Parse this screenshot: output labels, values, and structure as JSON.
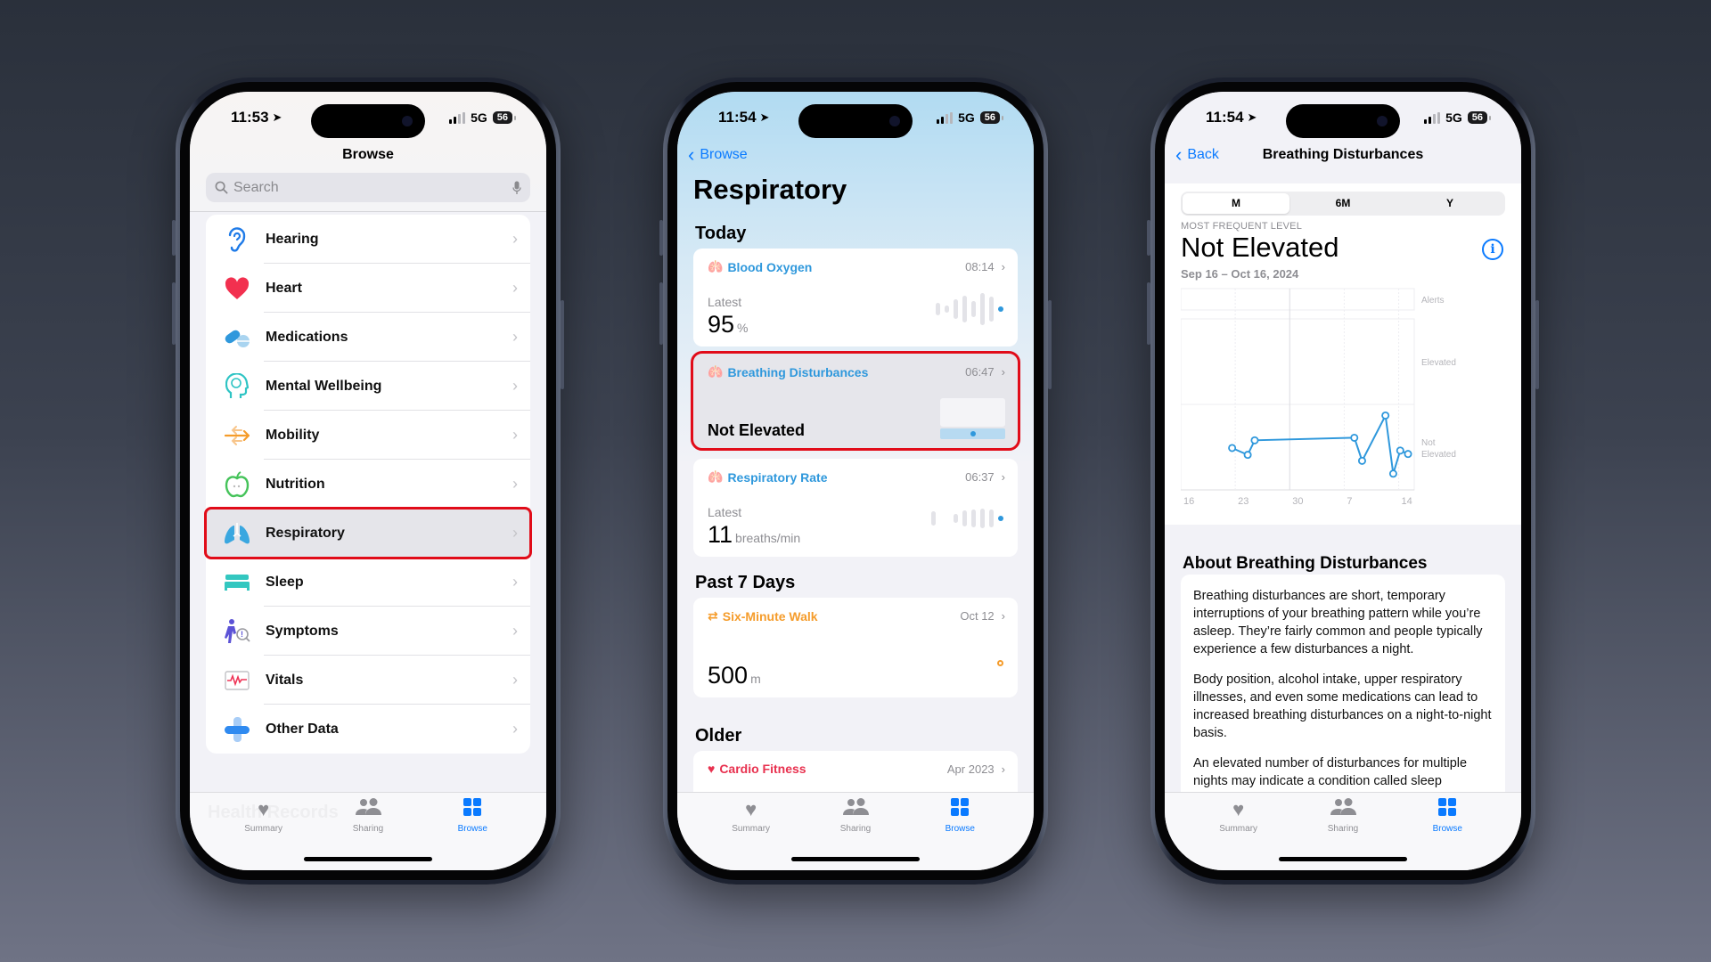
{
  "phones": [
    {
      "status": {
        "time": "11:53",
        "network": "5G",
        "battery": "56"
      },
      "nav_title": "Browse",
      "search": {
        "placeholder": "Search"
      },
      "categories": [
        {
          "label": "Hearing",
          "icon": "ear-icon",
          "color": "#1f7be8"
        },
        {
          "label": "Heart",
          "icon": "heart-icon",
          "color": "#f2304f"
        },
        {
          "label": "Medications",
          "icon": "pill-icon",
          "color": "#2f98dc"
        },
        {
          "label": "Mental Wellbeing",
          "icon": "brain-head-icon",
          "color": "#2ec4c4"
        },
        {
          "label": "Mobility",
          "icon": "arrows-icon",
          "color": "#f59c2b"
        },
        {
          "label": "Nutrition",
          "icon": "apple-icon",
          "color": "#45c35a"
        },
        {
          "label": "Respiratory",
          "icon": "lungs-icon",
          "color": "#3aa7e0",
          "highlighted": true
        },
        {
          "label": "Sleep",
          "icon": "bed-icon",
          "color": "#33c7c0"
        },
        {
          "label": "Symptoms",
          "icon": "person-magnifier-icon",
          "color": "#5b52d6"
        },
        {
          "label": "Vitals",
          "icon": "vitals-waveform-icon",
          "color": "#ee3456"
        },
        {
          "label": "Other Data",
          "icon": "plus-cross-icon",
          "color": "#2f8af0"
        }
      ],
      "section_heading": "Health Records"
    },
    {
      "status": {
        "time": "11:54",
        "network": "5G",
        "battery": "56"
      },
      "back_label": "Browse",
      "title": "Respiratory",
      "sections": {
        "today": "Today",
        "past7": "Past 7 Days",
        "older": "Older"
      },
      "cards": {
        "blood_oxygen": {
          "title": "Blood Oxygen",
          "time": "08:14",
          "latest_label": "Latest",
          "value": "95",
          "unit": "%",
          "color": "#2f98dc"
        },
        "breathing": {
          "title": "Breathing Disturbances",
          "time": "06:47",
          "value": "Not Elevated",
          "color": "#2f98dc",
          "highlighted": true
        },
        "resp_rate": {
          "title": "Respiratory Rate",
          "time": "06:37",
          "latest_label": "Latest",
          "value": "11",
          "unit": "breaths/min",
          "color": "#2f98dc"
        },
        "six_min_walk": {
          "title": "Six-Minute Walk",
          "time": "Oct 12",
          "value": "500",
          "unit": "m",
          "color": "#f59c2b"
        },
        "cardio": {
          "title": "Cardio Fitness",
          "time": "Apr 2023",
          "color": "#e8314f"
        }
      }
    },
    {
      "status": {
        "time": "11:54",
        "network": "5G",
        "battery": "56"
      },
      "back_label": "Back",
      "nav_title": "Breathing Disturbances",
      "segments": [
        "M",
        "6M",
        "Y"
      ],
      "selected_segment": "M",
      "summary_label": "MOST FREQUENT LEVEL",
      "summary_value": "Not Elevated",
      "date_range": "Sep 16 – Oct 16, 2024",
      "about_heading": "About Breathing Disturbances",
      "about_paragraphs": [
        "Breathing disturbances are short, temporary interruptions of your breathing pattern while you’re asleep. They’re fairly common and people typically experience a few disturbances a night.",
        "Body position, alcohol intake, upper respiratory illnesses, and even some medications can lead to increased breathing disturbances on a night-to-night basis.",
        "An elevated number of disturbances for multiple nights may indicate a condition called sleep"
      ]
    }
  ],
  "tabbar": [
    {
      "label": "Summary",
      "icon": "heart-icon"
    },
    {
      "label": "Sharing",
      "icon": "people-icon"
    },
    {
      "label": "Browse",
      "icon": "grid-icon",
      "active": true
    }
  ],
  "chart_data": {
    "type": "line",
    "title": "Breathing Disturbances",
    "xlabel": "",
    "ylabel": "",
    "x_ticks": [
      "16",
      "23",
      "30",
      "7",
      "14"
    ],
    "x_range_days": [
      0,
      30
    ],
    "y_bands": [
      "Not Elevated",
      "Elevated"
    ],
    "top_band": "Alerts",
    "y_range": [
      0,
      2
    ],
    "grid": true,
    "series": [
      {
        "name": "Breathing disturbances",
        "color": "#2f98dc",
        "points": [
          {
            "day": 6.6,
            "value": 0.49
          },
          {
            "day": 8.6,
            "value": 0.41
          },
          {
            "day": 9.5,
            "value": 0.58
          },
          {
            "day": 22.3,
            "value": 0.61
          },
          {
            "day": 23.3,
            "value": 0.34
          },
          {
            "day": 26.3,
            "value": 0.87
          },
          {
            "day": 27.3,
            "value": 0.19
          },
          {
            "day": 28.2,
            "value": 0.46
          },
          {
            "day": 29.2,
            "value": 0.42
          }
        ]
      }
    ]
  }
}
